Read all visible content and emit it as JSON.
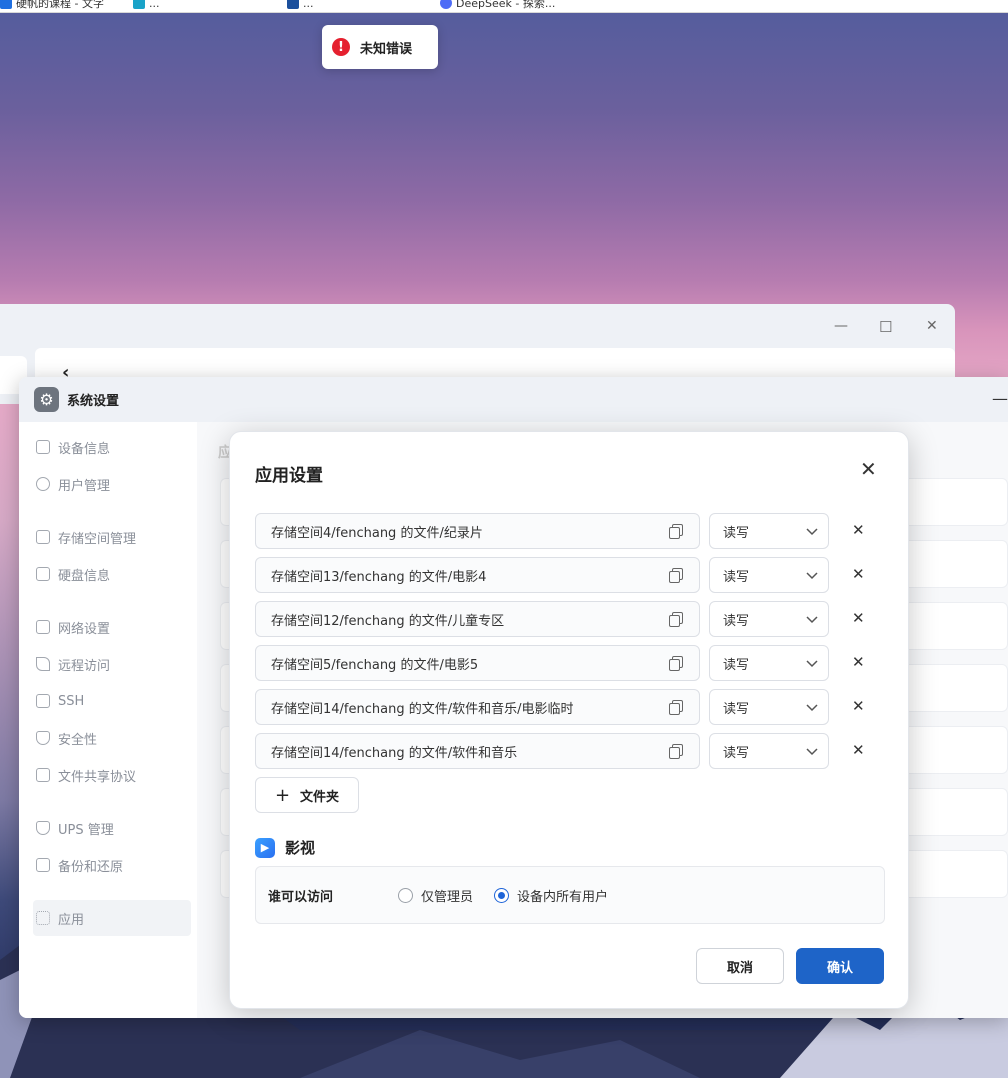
{
  "browser": {
    "bookmarks": [
      "硬帆的课程 - 文字",
      "...",
      "...",
      "DeepSeek - 探索..."
    ]
  },
  "toast": {
    "message": "未知错误",
    "icon": "error-icon",
    "color": "#e5202f"
  },
  "settings_window": {
    "title": "系统设置",
    "sidebar": [
      {
        "label": "设备信息",
        "icon": "device-icon"
      },
      {
        "label": "用户管理",
        "icon": "user-icon"
      },
      {
        "label": "存储空间管理",
        "icon": "storage-icon"
      },
      {
        "label": "硬盘信息",
        "icon": "disk-icon"
      },
      {
        "label": "网络设置",
        "icon": "network-icon"
      },
      {
        "label": "远程访问",
        "icon": "remote-icon"
      },
      {
        "label": "SSH",
        "icon": "ssh-icon"
      },
      {
        "label": "安全性",
        "icon": "shield-icon"
      },
      {
        "label": "文件共享协议",
        "icon": "file-share-icon"
      },
      {
        "label": "UPS 管理",
        "icon": "ups-icon"
      },
      {
        "label": "备份和还原",
        "icon": "backup-icon"
      },
      {
        "label": "应用",
        "icon": "apps-icon",
        "active": true
      }
    ],
    "main_heading": "应"
  },
  "dialog": {
    "title": "应用设置",
    "folders": [
      {
        "path": "存储空间4/fenchang 的文件/纪录片",
        "permission": "读写"
      },
      {
        "path": "存储空间13/fenchang 的文件/电影4",
        "permission": "读写"
      },
      {
        "path": "存储空间12/fenchang 的文件/儿童专区",
        "permission": "读写"
      },
      {
        "path": "存储空间5/fenchang 的文件/电影5",
        "permission": "读写"
      },
      {
        "path": "存储空间14/fenchang 的文件/软件和音乐/电影临时",
        "permission": "读写"
      },
      {
        "path": "存储空间14/fenchang 的文件/软件和音乐",
        "permission": "读写"
      }
    ],
    "add_folder_label": "文件夹",
    "section": {
      "title": "影视",
      "access_label": "谁可以访问",
      "options": [
        {
          "label": "仅管理员",
          "checked": false
        },
        {
          "label": "设备内所有用户",
          "checked": true
        }
      ]
    },
    "cancel_label": "取消",
    "confirm_label": "确认",
    "accent_color": "#1e64c8"
  }
}
